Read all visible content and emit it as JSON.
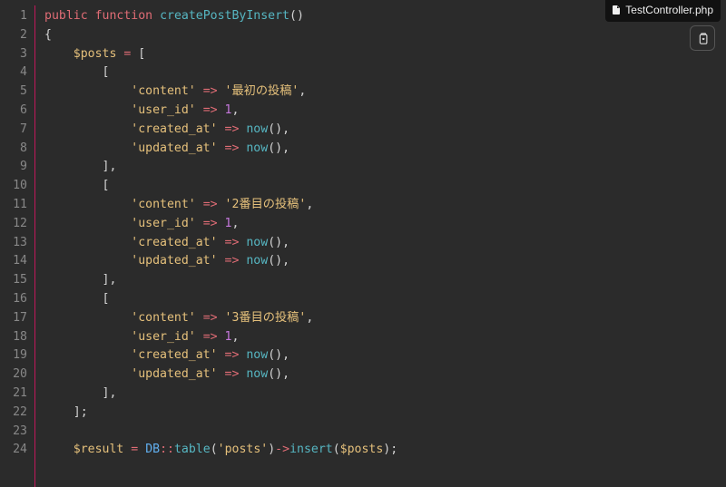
{
  "filename": "TestController.php",
  "copy_tooltip": "Copy",
  "code_lines": [
    [
      [
        "kw",
        "public"
      ],
      [
        "punc",
        " "
      ],
      [
        "kw",
        "function"
      ],
      [
        "punc",
        " "
      ],
      [
        "fn",
        "createPostByInsert"
      ],
      [
        "punc",
        "()"
      ]
    ],
    [
      [
        "punc",
        "{"
      ]
    ],
    [
      [
        "punc",
        "    "
      ],
      [
        "var",
        "$posts"
      ],
      [
        "punc",
        " "
      ],
      [
        "op",
        "="
      ],
      [
        "punc",
        " ["
      ]
    ],
    [
      [
        "punc",
        "        ["
      ]
    ],
    [
      [
        "punc",
        "            "
      ],
      [
        "str",
        "'content'"
      ],
      [
        "punc",
        " "
      ],
      [
        "op",
        "=>"
      ],
      [
        "punc",
        " "
      ],
      [
        "str",
        "'最初の投稿'"
      ],
      [
        "punc",
        ","
      ]
    ],
    [
      [
        "punc",
        "            "
      ],
      [
        "str",
        "'user_id'"
      ],
      [
        "punc",
        " "
      ],
      [
        "op",
        "=>"
      ],
      [
        "punc",
        " "
      ],
      [
        "num",
        "1"
      ],
      [
        "punc",
        ","
      ]
    ],
    [
      [
        "punc",
        "            "
      ],
      [
        "str",
        "'created_at'"
      ],
      [
        "punc",
        " "
      ],
      [
        "op",
        "=>"
      ],
      [
        "punc",
        " "
      ],
      [
        "fn",
        "now"
      ],
      [
        "punc",
        "(),"
      ]
    ],
    [
      [
        "punc",
        "            "
      ],
      [
        "str",
        "'updated_at'"
      ],
      [
        "punc",
        " "
      ],
      [
        "op",
        "=>"
      ],
      [
        "punc",
        " "
      ],
      [
        "fn",
        "now"
      ],
      [
        "punc",
        "(),"
      ]
    ],
    [
      [
        "punc",
        "        ],"
      ]
    ],
    [
      [
        "punc",
        "        ["
      ]
    ],
    [
      [
        "punc",
        "            "
      ],
      [
        "str",
        "'content'"
      ],
      [
        "punc",
        " "
      ],
      [
        "op",
        "=>"
      ],
      [
        "punc",
        " "
      ],
      [
        "str",
        "'2番目の投稿'"
      ],
      [
        "punc",
        ","
      ]
    ],
    [
      [
        "punc",
        "            "
      ],
      [
        "str",
        "'user_id'"
      ],
      [
        "punc",
        " "
      ],
      [
        "op",
        "=>"
      ],
      [
        "punc",
        " "
      ],
      [
        "num",
        "1"
      ],
      [
        "punc",
        ","
      ]
    ],
    [
      [
        "punc",
        "            "
      ],
      [
        "str",
        "'created_at'"
      ],
      [
        "punc",
        " "
      ],
      [
        "op",
        "=>"
      ],
      [
        "punc",
        " "
      ],
      [
        "fn",
        "now"
      ],
      [
        "punc",
        "(),"
      ]
    ],
    [
      [
        "punc",
        "            "
      ],
      [
        "str",
        "'updated_at'"
      ],
      [
        "punc",
        " "
      ],
      [
        "op",
        "=>"
      ],
      [
        "punc",
        " "
      ],
      [
        "fn",
        "now"
      ],
      [
        "punc",
        "(),"
      ]
    ],
    [
      [
        "punc",
        "        ],"
      ]
    ],
    [
      [
        "punc",
        "        ["
      ]
    ],
    [
      [
        "punc",
        "            "
      ],
      [
        "str",
        "'content'"
      ],
      [
        "punc",
        " "
      ],
      [
        "op",
        "=>"
      ],
      [
        "punc",
        " "
      ],
      [
        "str",
        "'3番目の投稿'"
      ],
      [
        "punc",
        ","
      ]
    ],
    [
      [
        "punc",
        "            "
      ],
      [
        "str",
        "'user_id'"
      ],
      [
        "punc",
        " "
      ],
      [
        "op",
        "=>"
      ],
      [
        "punc",
        " "
      ],
      [
        "num",
        "1"
      ],
      [
        "punc",
        ","
      ]
    ],
    [
      [
        "punc",
        "            "
      ],
      [
        "str",
        "'created_at'"
      ],
      [
        "punc",
        " "
      ],
      [
        "op",
        "=>"
      ],
      [
        "punc",
        " "
      ],
      [
        "fn",
        "now"
      ],
      [
        "punc",
        "(),"
      ]
    ],
    [
      [
        "punc",
        "            "
      ],
      [
        "str",
        "'updated_at'"
      ],
      [
        "punc",
        " "
      ],
      [
        "op",
        "=>"
      ],
      [
        "punc",
        " "
      ],
      [
        "fn",
        "now"
      ],
      [
        "punc",
        "(),"
      ]
    ],
    [
      [
        "punc",
        "        ],"
      ]
    ],
    [
      [
        "punc",
        "    ];"
      ]
    ],
    [],
    [
      [
        "punc",
        "    "
      ],
      [
        "var",
        "$result"
      ],
      [
        "punc",
        " "
      ],
      [
        "op",
        "="
      ],
      [
        "punc",
        " "
      ],
      [
        "cls",
        "DB"
      ],
      [
        "op",
        "::"
      ],
      [
        "mth",
        "table"
      ],
      [
        "punc",
        "("
      ],
      [
        "str",
        "'posts'"
      ],
      [
        "punc",
        ")"
      ],
      [
        "op",
        "->"
      ],
      [
        "mth",
        "insert"
      ],
      [
        "punc",
        "("
      ],
      [
        "var",
        "$posts"
      ],
      [
        "punc",
        ");"
      ]
    ]
  ]
}
